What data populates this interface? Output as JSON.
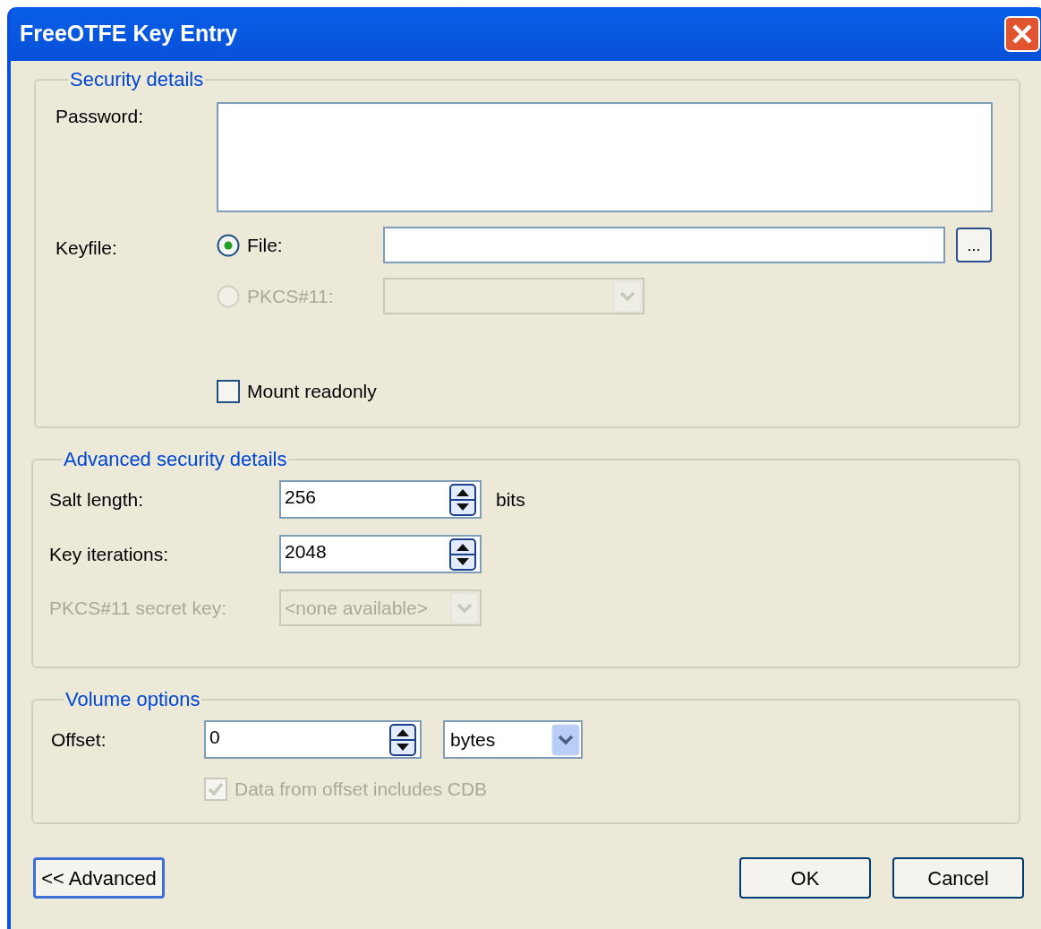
{
  "window": {
    "title": "FreeOTFE Key Entry"
  },
  "security_details": {
    "title": "Security details",
    "password": {
      "label": "Password:"
    },
    "keyfile": {
      "label": "Keyfile:",
      "options": [
        {
          "kind": "file",
          "label": "File:",
          "selected": true,
          "disabled": false
        },
        {
          "kind": "pkcs11",
          "label": "PKCS#11:",
          "selected": false,
          "disabled": true
        }
      ]
    },
    "browse_button": {
      "label": "..."
    },
    "mount_readonly": {
      "label": "Mount readonly",
      "checked": false,
      "disabled": false
    }
  },
  "advanced_security_details": {
    "title": "Advanced security details",
    "salt_length": {
      "label": "Salt length:",
      "value": "256",
      "unit": "bits"
    },
    "key_iterations": {
      "label": "Key iterations:",
      "value": "2048"
    },
    "pkcs11_secret_key": {
      "label": "PKCS#11 secret key:",
      "value": "<none available>",
      "disabled": true
    }
  },
  "volume_options": {
    "title": "Volume options",
    "offset": {
      "label": "Offset:",
      "value": "0",
      "unit": "bytes"
    },
    "includes_cdb": {
      "label": "Data from offset includes CDB",
      "checked": true,
      "disabled": true
    }
  },
  "buttons": [
    {
      "label": "<< Advanced",
      "focused": true
    },
    {
      "label": "OK",
      "focused": false
    },
    {
      "label": "Cancel",
      "focused": false
    }
  ]
}
